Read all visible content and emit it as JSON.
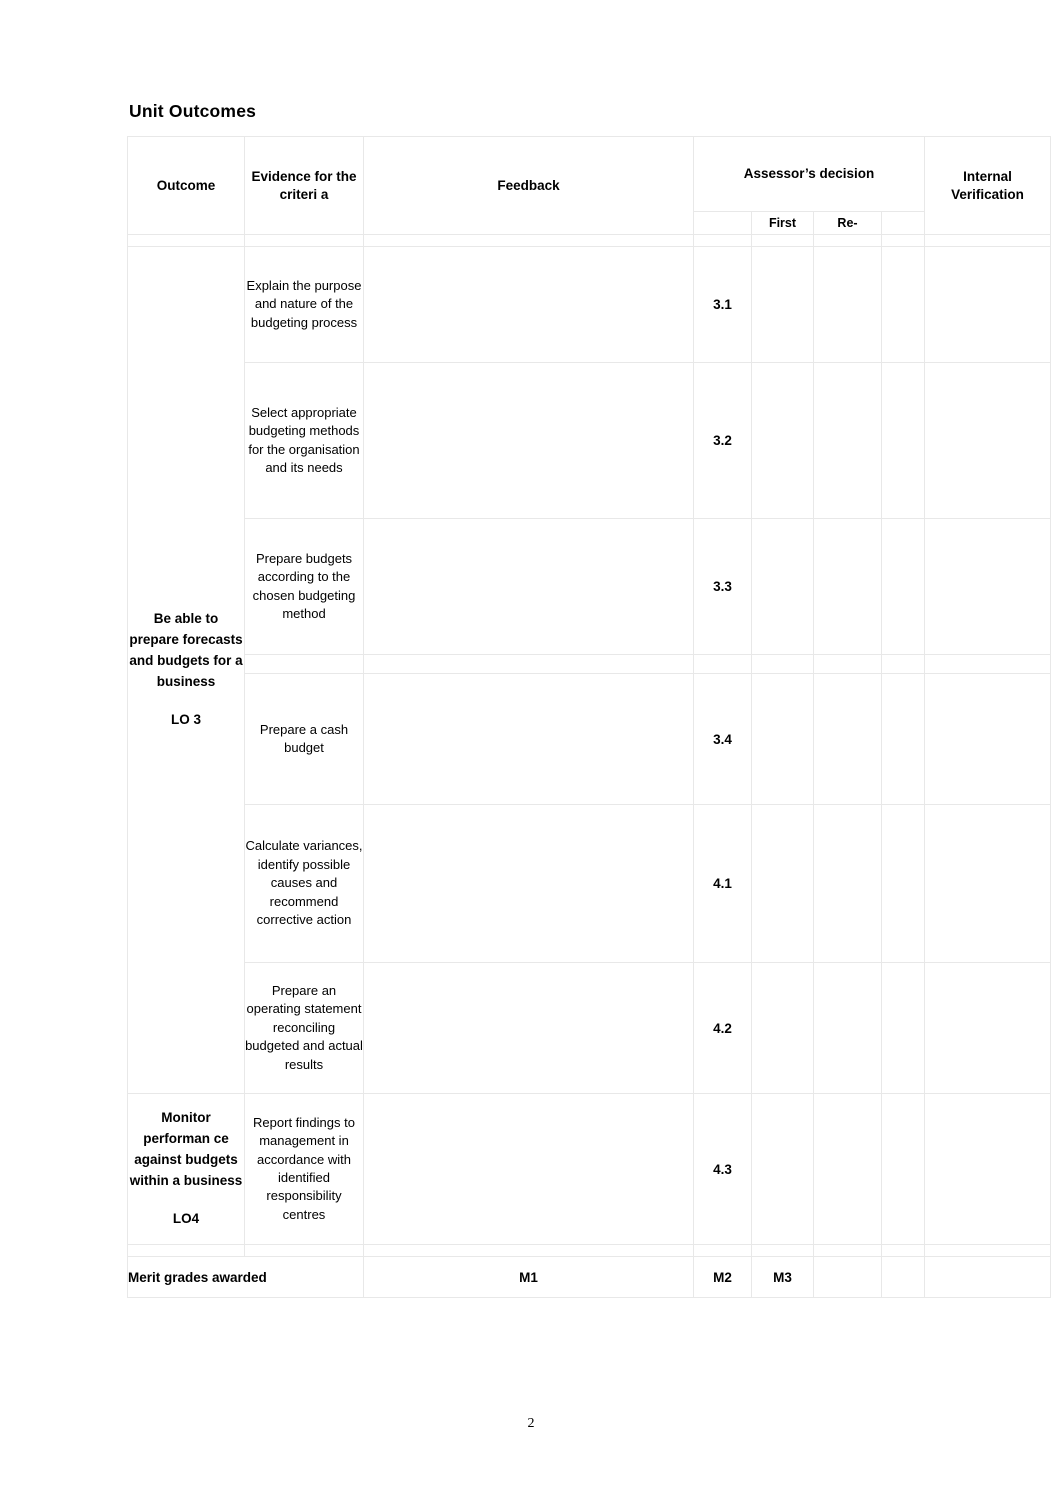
{
  "document": {
    "title": "Unit Outcomes",
    "page_number": "2"
  },
  "colors": {
    "internal_verification_green": "#00ee00",
    "merit_shade_gray": "#bfbfbf",
    "grid_border": "#e8e8e8"
  },
  "table": {
    "headers": {
      "outcome": "Outcome",
      "evidence": "Evidence for the criteri a",
      "feedback": "Feedback",
      "assessor_decision": "Assessor’s decision",
      "internal_verification": "Internal Verification"
    },
    "subheaders": {
      "first": "First",
      "re": "Re-"
    },
    "groups": [
      {
        "outcome_title": "Be able to prepare forecasts and budgets for a business",
        "outcome_lo": "LO 3",
        "rows": [
          {
            "evidence": "Explain the purpose and nature of the budgeting process",
            "criteria": "3.1",
            "feedback": "",
            "first": "",
            "re": ""
          },
          {
            "evidence": "Select appropriate budgeting methods for the organisation and its needs",
            "criteria": "3.2",
            "feedback": "",
            "first": "",
            "re": ""
          },
          {
            "evidence": "Prepare budgets according to the chosen budgeting method",
            "criteria": "3.3",
            "feedback": "",
            "first": "",
            "re": ""
          },
          {
            "evidence": "Prepare a cash budget",
            "criteria": "3.4",
            "feedback": "",
            "first": "",
            "re": ""
          }
        ]
      },
      {
        "outcome_title": "Monitor performan ce against budgets within a business",
        "outcome_lo": "LO4",
        "rows": [
          {
            "evidence": "Calculate variances, identify possible causes and recommend corrective action",
            "criteria": "4.1",
            "feedback": "",
            "first": "",
            "re": ""
          },
          {
            "evidence": "Prepare an operating statement reconciling budgeted and actual results",
            "criteria": "4.2",
            "feedback": "",
            "first": "",
            "re": ""
          },
          {
            "evidence": "Report findings to management in accordance with identified responsibility centres",
            "criteria": "4.3",
            "feedback": "",
            "first": "",
            "re": ""
          }
        ]
      }
    ],
    "footer": {
      "label": "Merit grades awarded",
      "m1": "M1",
      "m2": "M2",
      "m3": "M3"
    }
  }
}
